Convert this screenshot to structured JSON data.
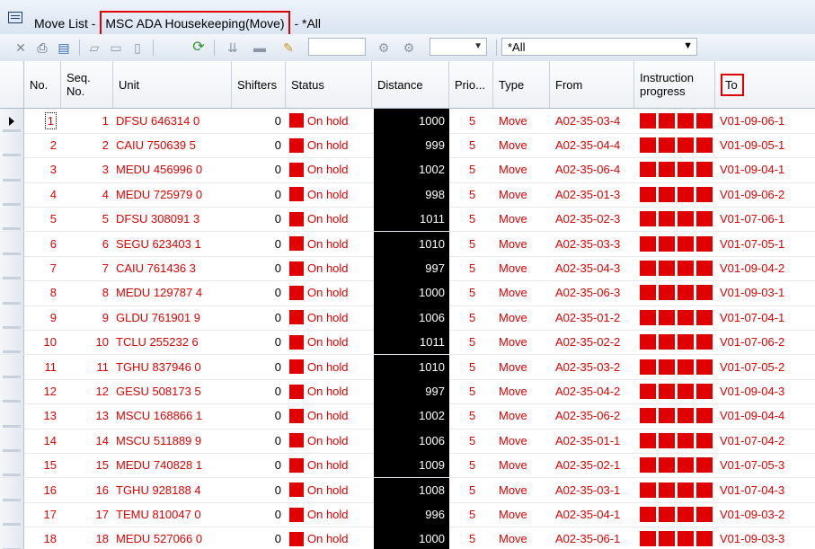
{
  "window": {
    "title_prefix": "Move List - ",
    "title_highlight": "MSC ADA Housekeeping(Move)",
    "title_suffix": " - *All"
  },
  "toolbar": {
    "icons": [
      "close-icon",
      "print-icon",
      "export-icon",
      "open-icon",
      "edit-icon",
      "delete-icon",
      "refresh-icon",
      "filter-icon",
      "transfer-icon",
      "sequence-icon",
      "vessel-icon",
      "vessel2-icon"
    ],
    "filter_value": "*All",
    "accent": "#e00000"
  },
  "table": {
    "columns": [
      "No.",
      "Seq. No.",
      "Unit",
      "Shifters",
      "Status",
      "Distance",
      "Prio...",
      "Type",
      "From",
      "Instruction progress",
      "To"
    ],
    "rows": [
      {
        "no": "1",
        "seq": "1",
        "unit": "DFSU 646314 0",
        "shifters": "0",
        "status": "On hold",
        "distance": "1000",
        "prio": "5",
        "type": "Move",
        "from": "A02-35-03-4",
        "to": "V01-09-06-1"
      },
      {
        "no": "2",
        "seq": "2",
        "unit": "CAIU 750639 5",
        "shifters": "0",
        "status": "On hold",
        "distance": "999",
        "prio": "5",
        "type": "Move",
        "from": "A02-35-04-4",
        "to": "V01-09-05-1"
      },
      {
        "no": "3",
        "seq": "3",
        "unit": "MEDU 456996 0",
        "shifters": "0",
        "status": "On hold",
        "distance": "1002",
        "prio": "5",
        "type": "Move",
        "from": "A02-35-06-4",
        "to": "V01-09-04-1"
      },
      {
        "no": "4",
        "seq": "4",
        "unit": "MEDU 725979 0",
        "shifters": "0",
        "status": "On hold",
        "distance": "998",
        "prio": "5",
        "type": "Move",
        "from": "A02-35-01-3",
        "to": "V01-09-06-2"
      },
      {
        "no": "5",
        "seq": "5",
        "unit": "DFSU 308091 3",
        "shifters": "0",
        "status": "On hold",
        "distance": "1011",
        "prio": "5",
        "type": "Move",
        "from": "A02-35-02-3",
        "to": "V01-07-06-1"
      },
      {
        "no": "6",
        "seq": "6",
        "unit": "SEGU 623403 1",
        "shifters": "0",
        "status": "On hold",
        "distance": "1010",
        "prio": "5",
        "type": "Move",
        "from": "A02-35-03-3",
        "to": "V01-07-05-1"
      },
      {
        "no": "7",
        "seq": "7",
        "unit": "CAIU 761436 3",
        "shifters": "0",
        "status": "On hold",
        "distance": "997",
        "prio": "5",
        "type": "Move",
        "from": "A02-35-04-3",
        "to": "V01-09-04-2"
      },
      {
        "no": "8",
        "seq": "8",
        "unit": "MEDU 129787 4",
        "shifters": "0",
        "status": "On hold",
        "distance": "1000",
        "prio": "5",
        "type": "Move",
        "from": "A02-35-06-3",
        "to": "V01-09-03-1"
      },
      {
        "no": "9",
        "seq": "9",
        "unit": "GLDU 761901 9",
        "shifters": "0",
        "status": "On hold",
        "distance": "1006",
        "prio": "5",
        "type": "Move",
        "from": "A02-35-01-2",
        "to": "V01-07-04-1"
      },
      {
        "no": "10",
        "seq": "10",
        "unit": "TCLU 255232 6",
        "shifters": "0",
        "status": "On hold",
        "distance": "1011",
        "prio": "5",
        "type": "Move",
        "from": "A02-35-02-2",
        "to": "V01-07-06-2"
      },
      {
        "no": "11",
        "seq": "11",
        "unit": "TGHU 837946 0",
        "shifters": "0",
        "status": "On hold",
        "distance": "1010",
        "prio": "5",
        "type": "Move",
        "from": "A02-35-03-2",
        "to": "V01-07-05-2"
      },
      {
        "no": "12",
        "seq": "12",
        "unit": "GESU 508173 5",
        "shifters": "0",
        "status": "On hold",
        "distance": "997",
        "prio": "5",
        "type": "Move",
        "from": "A02-35-04-2",
        "to": "V01-09-04-3"
      },
      {
        "no": "13",
        "seq": "13",
        "unit": "MSCU 168866 1",
        "shifters": "0",
        "status": "On hold",
        "distance": "1002",
        "prio": "5",
        "type": "Move",
        "from": "A02-35-06-2",
        "to": "V01-09-04-4"
      },
      {
        "no": "14",
        "seq": "14",
        "unit": "MSCU 511889 9",
        "shifters": "0",
        "status": "On hold",
        "distance": "1006",
        "prio": "5",
        "type": "Move",
        "from": "A02-35-01-1",
        "to": "V01-07-04-2"
      },
      {
        "no": "15",
        "seq": "15",
        "unit": "MEDU 740828 1",
        "shifters": "0",
        "status": "On hold",
        "distance": "1009",
        "prio": "5",
        "type": "Move",
        "from": "A02-35-02-1",
        "to": "V01-07-05-3"
      },
      {
        "no": "16",
        "seq": "16",
        "unit": "TGHU 928188 4",
        "shifters": "0",
        "status": "On hold",
        "distance": "1008",
        "prio": "5",
        "type": "Move",
        "from": "A02-35-03-1",
        "to": "V01-07-04-3"
      },
      {
        "no": "17",
        "seq": "17",
        "unit": "TEMU 810047 0",
        "shifters": "0",
        "status": "On hold",
        "distance": "996",
        "prio": "5",
        "type": "Move",
        "from": "A02-35-04-1",
        "to": "V01-09-03-2"
      },
      {
        "no": "18",
        "seq": "18",
        "unit": "MEDU 527066 0",
        "shifters": "0",
        "status": "On hold",
        "distance": "1000",
        "prio": "5",
        "type": "Move",
        "from": "A02-35-06-1",
        "to": "V01-09-03-3"
      }
    ]
  }
}
